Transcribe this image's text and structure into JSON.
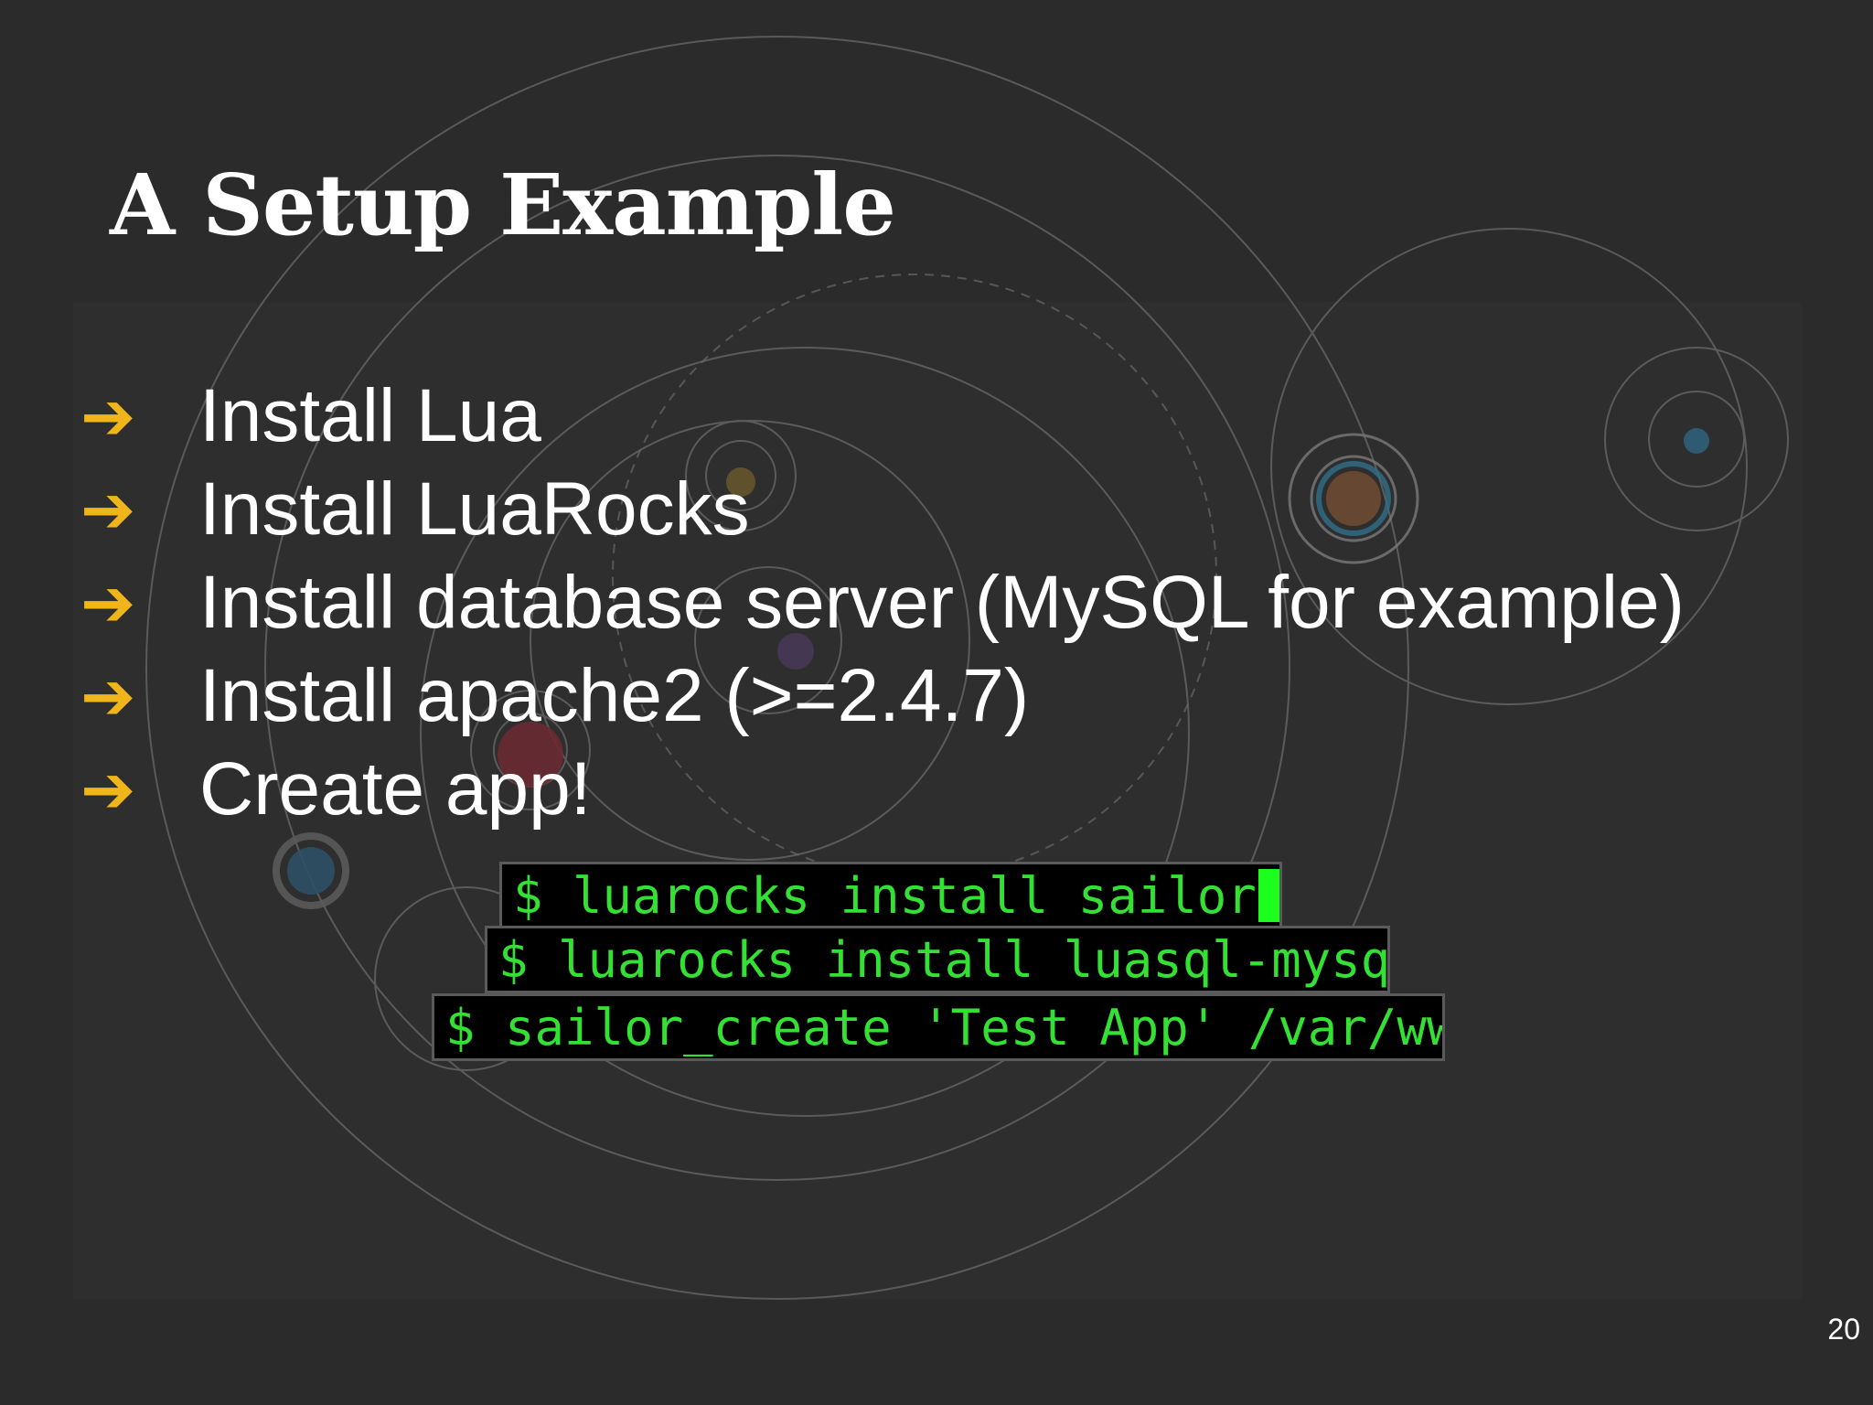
{
  "slide": {
    "title": "A Setup Example",
    "bullets": [
      {
        "icon": "arrow-right-icon",
        "text": "Install Lua"
      },
      {
        "icon": "arrow-right-icon",
        "text": "Install LuaRocks"
      },
      {
        "icon": "arrow-right-icon",
        "text": "Install database server (MySQL for example)"
      },
      {
        "icon": "arrow-right-icon",
        "text": "Install apache2 (>=2.4.7)"
      },
      {
        "icon": "arrow-right-icon",
        "text": "Create app!"
      }
    ],
    "terminal_commands": [
      "$ luarocks install sailor",
      "$ luarocks install luasql-mysql",
      "$ sailor_create 'Test App' /var/www"
    ],
    "page_number": "20"
  },
  "colors": {
    "background": "#2b2b2b",
    "accent_arrow": "#f1b51c",
    "text": "#ffffff",
    "terminal_bg": "#000000",
    "terminal_text": "#34e034",
    "cursor": "#1cff1c"
  }
}
